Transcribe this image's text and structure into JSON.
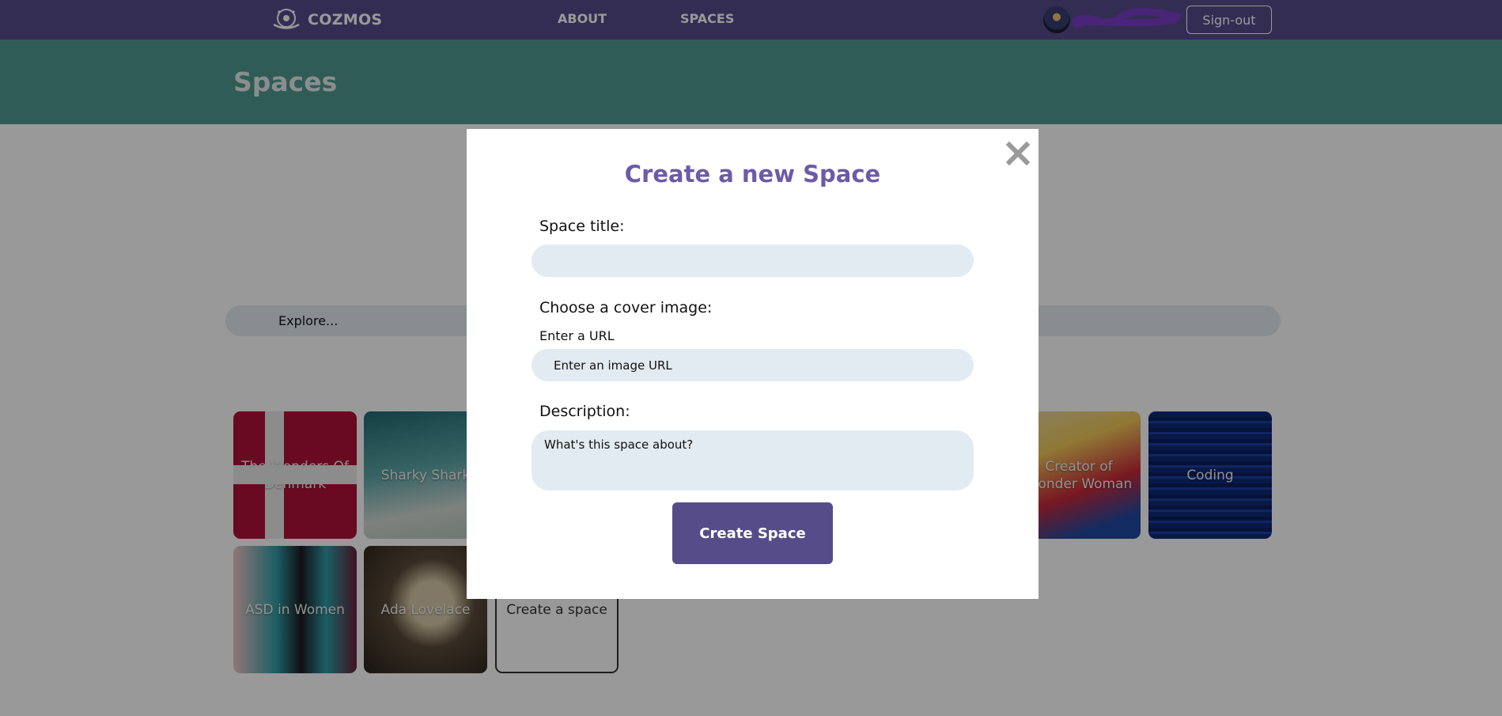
{
  "nav": {
    "brand": "COZMOS",
    "about": "ABOUT",
    "spaces": "SPACES",
    "signout": "Sign-out"
  },
  "hero": {
    "title": "Spaces"
  },
  "search": {
    "placeholder": "Explore..."
  },
  "cards": [
    {
      "label": "The Wonders Of Denmark"
    },
    {
      "label": "Sharky Shark"
    },
    {
      "label": "Creator of Wonder Woman"
    },
    {
      "label": "Coding"
    },
    {
      "label": "ASD in Women"
    },
    {
      "label": "Ada Lovelace"
    },
    {
      "label": "Create a space"
    }
  ],
  "modal": {
    "title": "Create a new Space",
    "title_label": "Space title:",
    "cover_label": "Choose a cover image:",
    "url_label": "Enter a URL",
    "url_placeholder": "Enter an image URL",
    "description_label": "Description:",
    "description_placeholder": "What's this space about?",
    "submit": "Create Space"
  },
  "colors": {
    "nav": "#574c8a",
    "hero": "#4f9a8f",
    "title_accent": "#6b5ba8",
    "input_bg": "#e2ebf1"
  },
  "icons": [
    "brand-logo-icon",
    "avatar",
    "close-icon"
  ]
}
